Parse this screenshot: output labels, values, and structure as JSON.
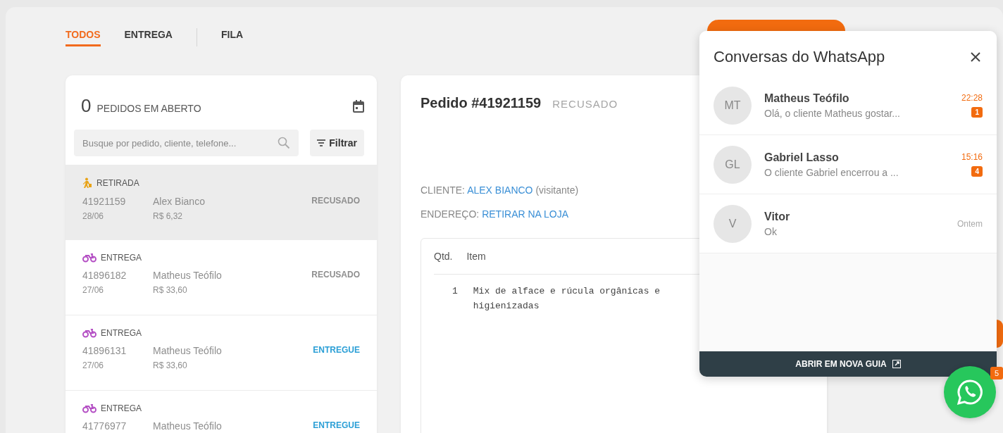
{
  "tabs": [
    {
      "label": "TODOS",
      "selected": true
    },
    {
      "label": "ENTREGA",
      "selected": false
    },
    {
      "label": "FILA",
      "selected": false
    }
  ],
  "orders_panel": {
    "count": "0",
    "count_label": "PEDIDOS EM ABERTO",
    "search": {
      "placeholder": "Busque por pedido, cliente, telefone..."
    },
    "filter_button": "Filtrar",
    "orders": [
      {
        "kind": "pickup",
        "type_label": "RETIRADA",
        "number": "41921159",
        "customer": "Alex Bianco",
        "date": "28/06",
        "total": "R$ 6,32",
        "status": {
          "label": "RECUSADO",
          "kind": "refused"
        },
        "selected": true
      },
      {
        "kind": "delivery",
        "type_label": "ENTREGA",
        "number": "41896182",
        "customer": "Matheus Teófilo",
        "date": "27/06",
        "total": "R$ 33,60",
        "status": {
          "label": "RECUSADO",
          "kind": "refused"
        },
        "selected": false
      },
      {
        "kind": "delivery",
        "type_label": "ENTREGA",
        "number": "41896131",
        "customer": "Matheus Teófilo",
        "date": "27/06",
        "total": "R$ 33,60",
        "status": {
          "label": "ENTREGUE",
          "kind": "delivered"
        },
        "selected": false
      },
      {
        "kind": "delivery",
        "type_label": "ENTREGA",
        "number": "41776977",
        "customer": "Matheus Teófilo",
        "status": {
          "label": "ENTREGUE",
          "kind": "delivered"
        },
        "selected": false
      }
    ]
  },
  "order_detail": {
    "title": "Pedido #41921159",
    "status": "RECUSADO",
    "client_label": "CLIENTE:",
    "client_name": "ALEX BIANCO",
    "client_note": "(visitante)",
    "address_label": "ENDEREÇO:",
    "address": "RETIRAR NA LOJA",
    "items": {
      "columns": [
        "Qtd.",
        "Item"
      ],
      "rows": [
        {
          "qty": "1",
          "item": "Mix de alface e rúcula orgânicas e higienizadas"
        }
      ]
    }
  },
  "whatsapp_panel": {
    "title": "Conversas do WhatsApp",
    "conversations": [
      {
        "initials": "MT",
        "name": "Matheus Teófilo",
        "preview": "Olá, o cliente Matheus gostar...",
        "time": "22:28",
        "unread": "1"
      },
      {
        "initials": "GL",
        "name": "Gabriel Lasso",
        "preview": "O cliente Gabriel encerrou a ...",
        "time": "15:16",
        "unread": "4"
      },
      {
        "initials": "V",
        "name": "Vitor",
        "preview": "Ok",
        "time": "Ontem"
      }
    ],
    "footer_button": "ABRIR EM NOVA GUIA"
  },
  "whatsapp_fab": {
    "badge": "5"
  }
}
